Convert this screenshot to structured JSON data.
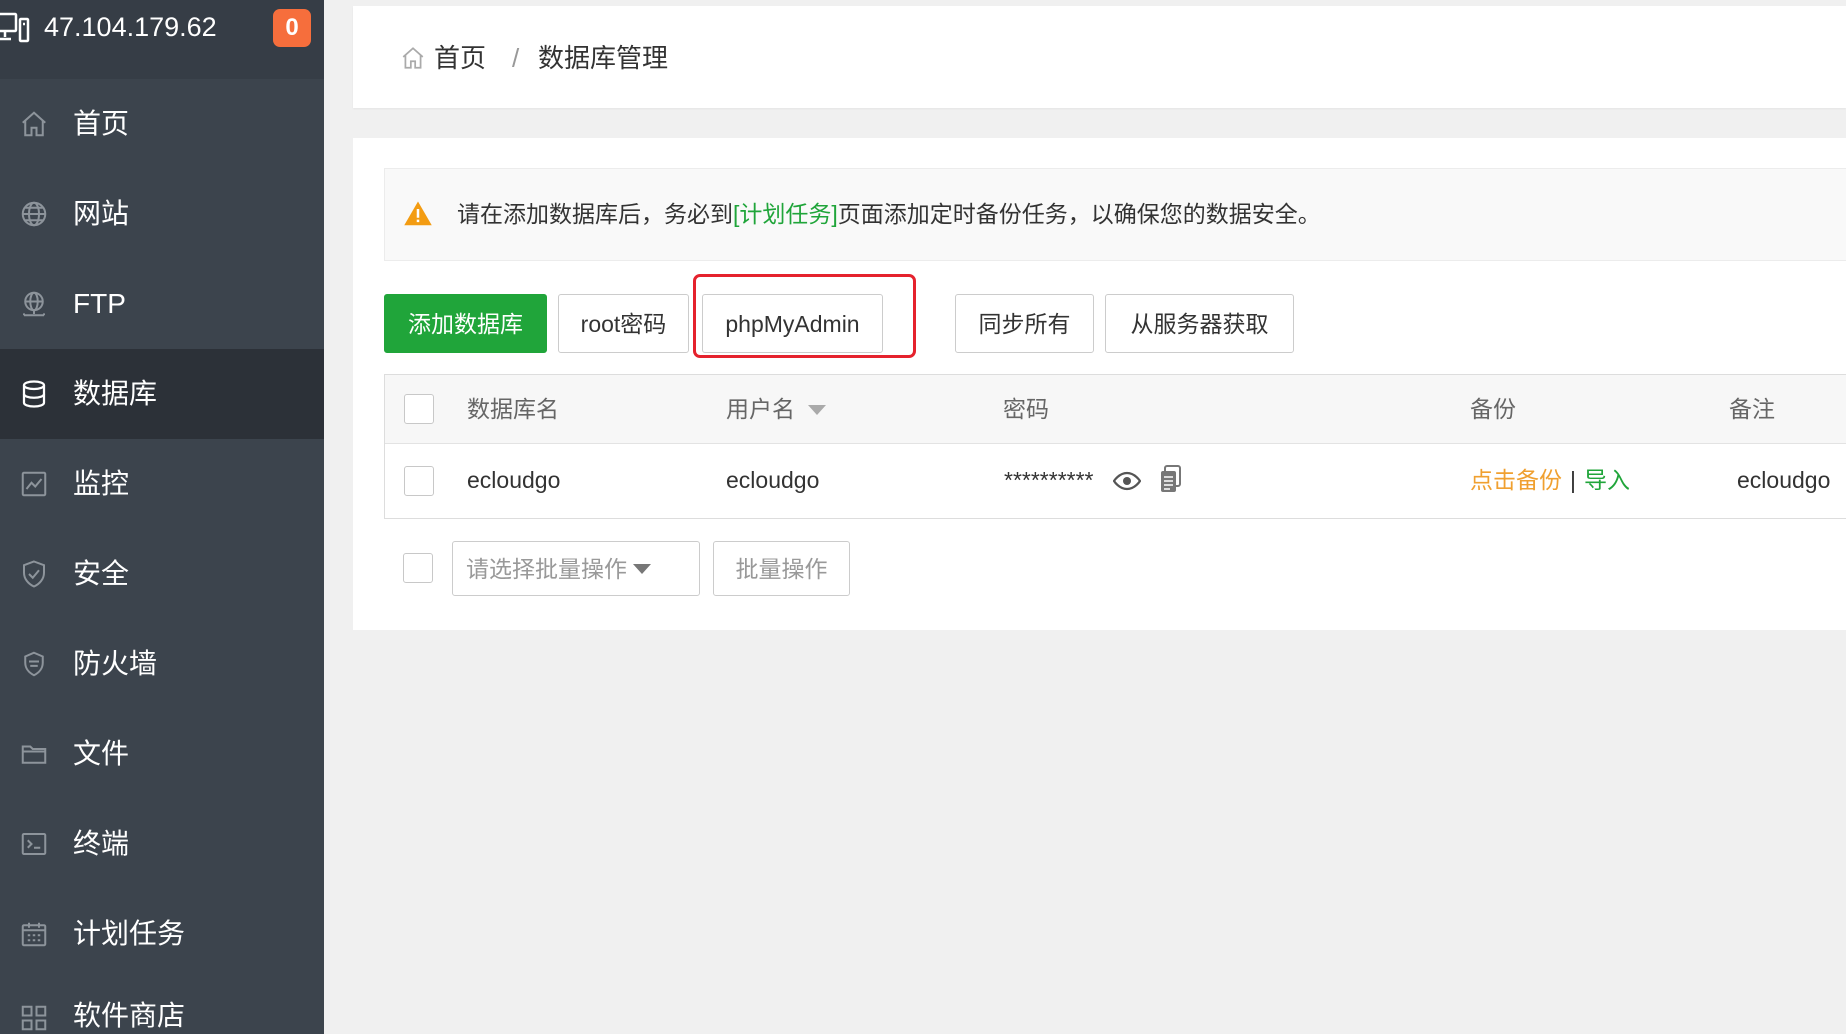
{
  "header": {
    "ip": "47.104.179.62",
    "badge": "0",
    "icon": "server-icon"
  },
  "sidebar": {
    "items": [
      {
        "label": "首页",
        "icon": "home-icon"
      },
      {
        "label": "网站",
        "icon": "globe-icon"
      },
      {
        "label": "FTP",
        "icon": "ftp-icon"
      },
      {
        "label": "数据库",
        "icon": "database-icon",
        "active": true
      },
      {
        "label": "监控",
        "icon": "monitor-icon"
      },
      {
        "label": "安全",
        "icon": "shield-icon"
      },
      {
        "label": "防火墙",
        "icon": "waf-shield-icon"
      },
      {
        "label": "文件",
        "icon": "folder-icon"
      },
      {
        "label": "终端",
        "icon": "terminal-icon"
      },
      {
        "label": "计划任务",
        "icon": "calendar-icon"
      },
      {
        "label": "软件商店",
        "icon": "app-grid-icon"
      }
    ]
  },
  "breadcrumb": {
    "home": "首页",
    "separator": "/",
    "current": "数据库管理"
  },
  "alert": {
    "icon": "warning-icon",
    "text_before": "请在添加数据库后，务必到",
    "link": "[计划任务]",
    "text_after": "页面添加定时备份任务，以确保您的数据安全。"
  },
  "toolbar": {
    "add_database": "添加数据库",
    "root_password": "root密码",
    "phpmyadmin": "phpMyAdmin",
    "sync_all": "同步所有",
    "fetch_from_server": "从服务器获取"
  },
  "table": {
    "columns": {
      "name": "数据库名",
      "username": "用户名",
      "password": "密码",
      "backup": "备份",
      "remark": "备注"
    },
    "sort_icon": "caret-down-icon",
    "rows": [
      {
        "name": "ecloudgo",
        "username": "ecloudgo",
        "password": "**********",
        "backup_action": "点击备份",
        "separator": "|",
        "import_action": "导入",
        "remark": "ecloudgo"
      }
    ]
  },
  "batch": {
    "select_placeholder": "请选择批量操作",
    "button": "批量操作"
  },
  "colors": {
    "sidebar_bg": "#3c444d",
    "sidebar_active_bg": "#2c3138",
    "accent_green": "#20a53a",
    "badge": "#f66e3c",
    "highlight_red": "#e5222d",
    "backup_orange": "#f0a030"
  }
}
